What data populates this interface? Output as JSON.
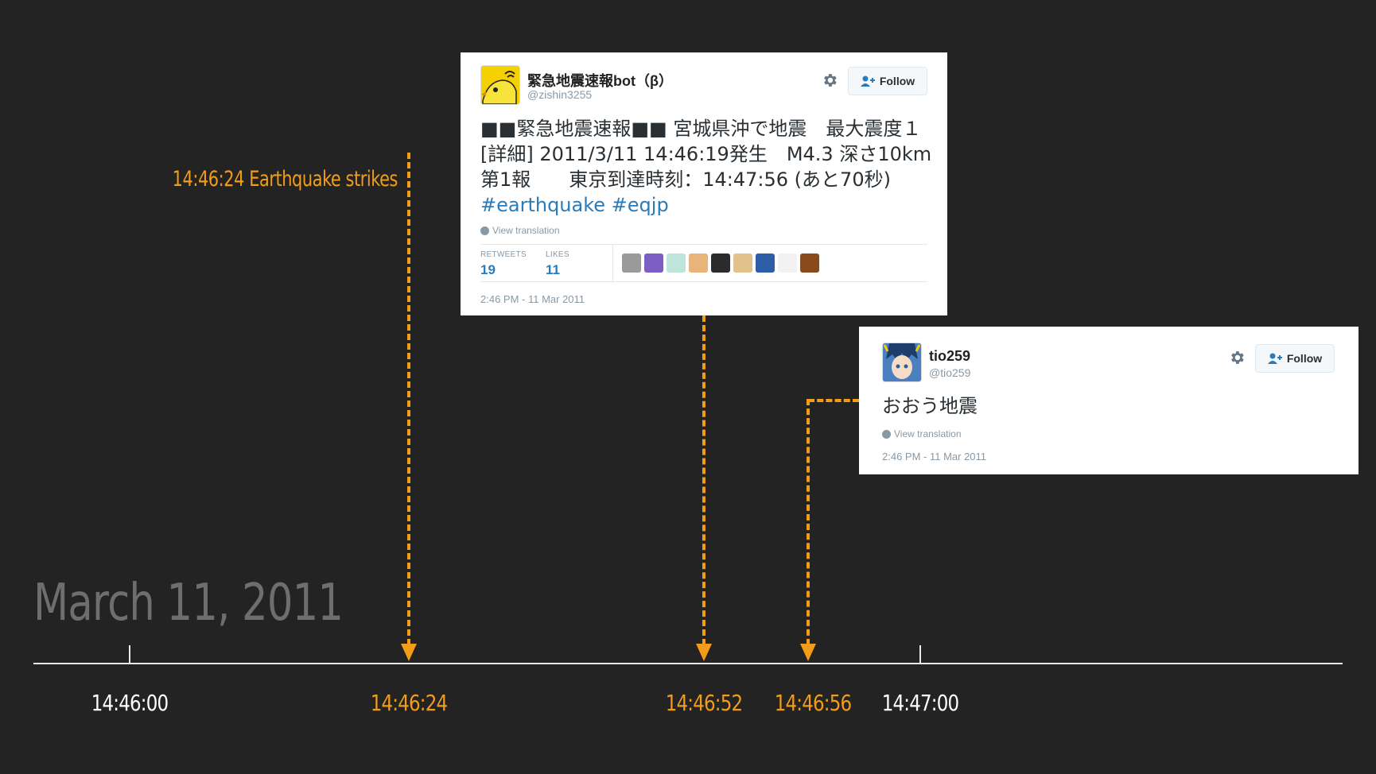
{
  "slide": {
    "event_label": "14:46:24 Earthquake strikes",
    "date_title": "March 11, 2011"
  },
  "timeline": {
    "labels": [
      "14:46:00",
      "14:46:24",
      "14:46:52",
      "14:46:56",
      "14:47:00"
    ],
    "colors": {
      "accent": "#f39c1a",
      "axis": "#e9e9e9",
      "muted": "#6e6e6e",
      "background": "#232323"
    }
  },
  "tweets": [
    {
      "name": "緊急地震速報bot（β）",
      "handle": "@zishin3255",
      "follow_label": "Follow",
      "text": "■■緊急地震速報■■ 宮城県沖で地震　最大震度１ [詳細] 2011/3/11 14:46:19発生　M4.3 深さ10km 第1報　　東京到達時刻：14:47:56 (あと70秒) ",
      "hashtags": "#earthquake #eqjp",
      "view_translation": "View translation",
      "retweets_label": "RETWEETS",
      "retweets": "19",
      "likes_label": "LIKES",
      "likes": "11",
      "timestamp": "2:46 PM - 11 Mar 2011",
      "avatar_icon": "yellow-bird-icon"
    },
    {
      "name": "tio259",
      "handle": "@tio259",
      "follow_label": "Follow",
      "text": "おおう地震",
      "view_translation": "View translation",
      "timestamp": "2:46 PM - 11 Mar 2011",
      "avatar_icon": "anime-avatar-icon"
    }
  ]
}
